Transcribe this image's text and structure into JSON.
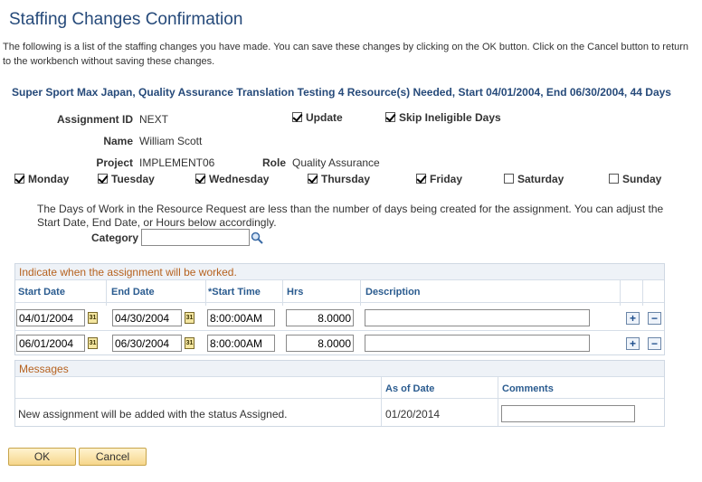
{
  "page": {
    "title": "Staffing Changes Confirmation",
    "intro": "The following is a list of the staffing changes you have made. You can save these changes by clicking on the OK button. Click on the Cancel button to return to the workbench without saving these changes.",
    "request_header": "Super Sport Max Japan, Quality Assurance Translation Testing 4 Resource(s) Needed, Start 04/01/2004, End 06/30/2004, 44 Days"
  },
  "assignment": {
    "id_label": "Assignment ID",
    "id_value": "NEXT",
    "name_label": "Name",
    "name_value": "William Scott",
    "project_label": "Project",
    "project_value": "IMPLEMENT06",
    "role_label": "Role",
    "role_value": "Quality Assurance",
    "update_label": "Update",
    "update_checked": true,
    "skip_label": "Skip Ineligible Days",
    "skip_checked": true
  },
  "days": [
    {
      "label": "Monday",
      "checked": true
    },
    {
      "label": "Tuesday",
      "checked": true
    },
    {
      "label": "Wednesday",
      "checked": true
    },
    {
      "label": "Thursday",
      "checked": true
    },
    {
      "label": "Friday",
      "checked": true
    },
    {
      "label": "Saturday",
      "checked": false
    },
    {
      "label": "Sunday",
      "checked": false
    }
  ],
  "note": "The Days of Work in the Resource Request are less than the number of days being created for the assignment.  You can adjust the Start Date, End Date, or Hours below accordingly.",
  "category": {
    "label": "Category",
    "value": ""
  },
  "schedule": {
    "title": "Indicate when the assignment will be worked.",
    "headers": {
      "start": "Start Date",
      "end": "End Date",
      "time": "*Start Time",
      "hrs": "Hrs",
      "desc": "Description"
    },
    "calendar_icon_text": "31",
    "rows": [
      {
        "start": "04/01/2004",
        "end": "04/30/2004",
        "time": "8:00:00AM",
        "hrs": "8.0000",
        "desc": ""
      },
      {
        "start": "06/01/2004",
        "end": "06/30/2004",
        "time": "8:00:00AM",
        "hrs": "8.0000",
        "desc": ""
      }
    ],
    "add_symbol": "+",
    "remove_symbol": "−"
  },
  "messages": {
    "title": "Messages",
    "headers": {
      "as_of": "As of Date",
      "comments": "Comments"
    },
    "row": {
      "text": "New assignment will be added with the status Assigned.",
      "as_of": "01/20/2014",
      "comments": ""
    }
  },
  "buttons": {
    "ok": "OK",
    "cancel": "Cancel"
  },
  "icons": {
    "search": "search-icon",
    "calendar": "calendar-icon",
    "add": "add-row-icon",
    "remove": "delete-row-icon"
  },
  "colors": {
    "title": "#264a7a",
    "section_title": "#b6621f",
    "column_header": "#2a5b8f"
  }
}
